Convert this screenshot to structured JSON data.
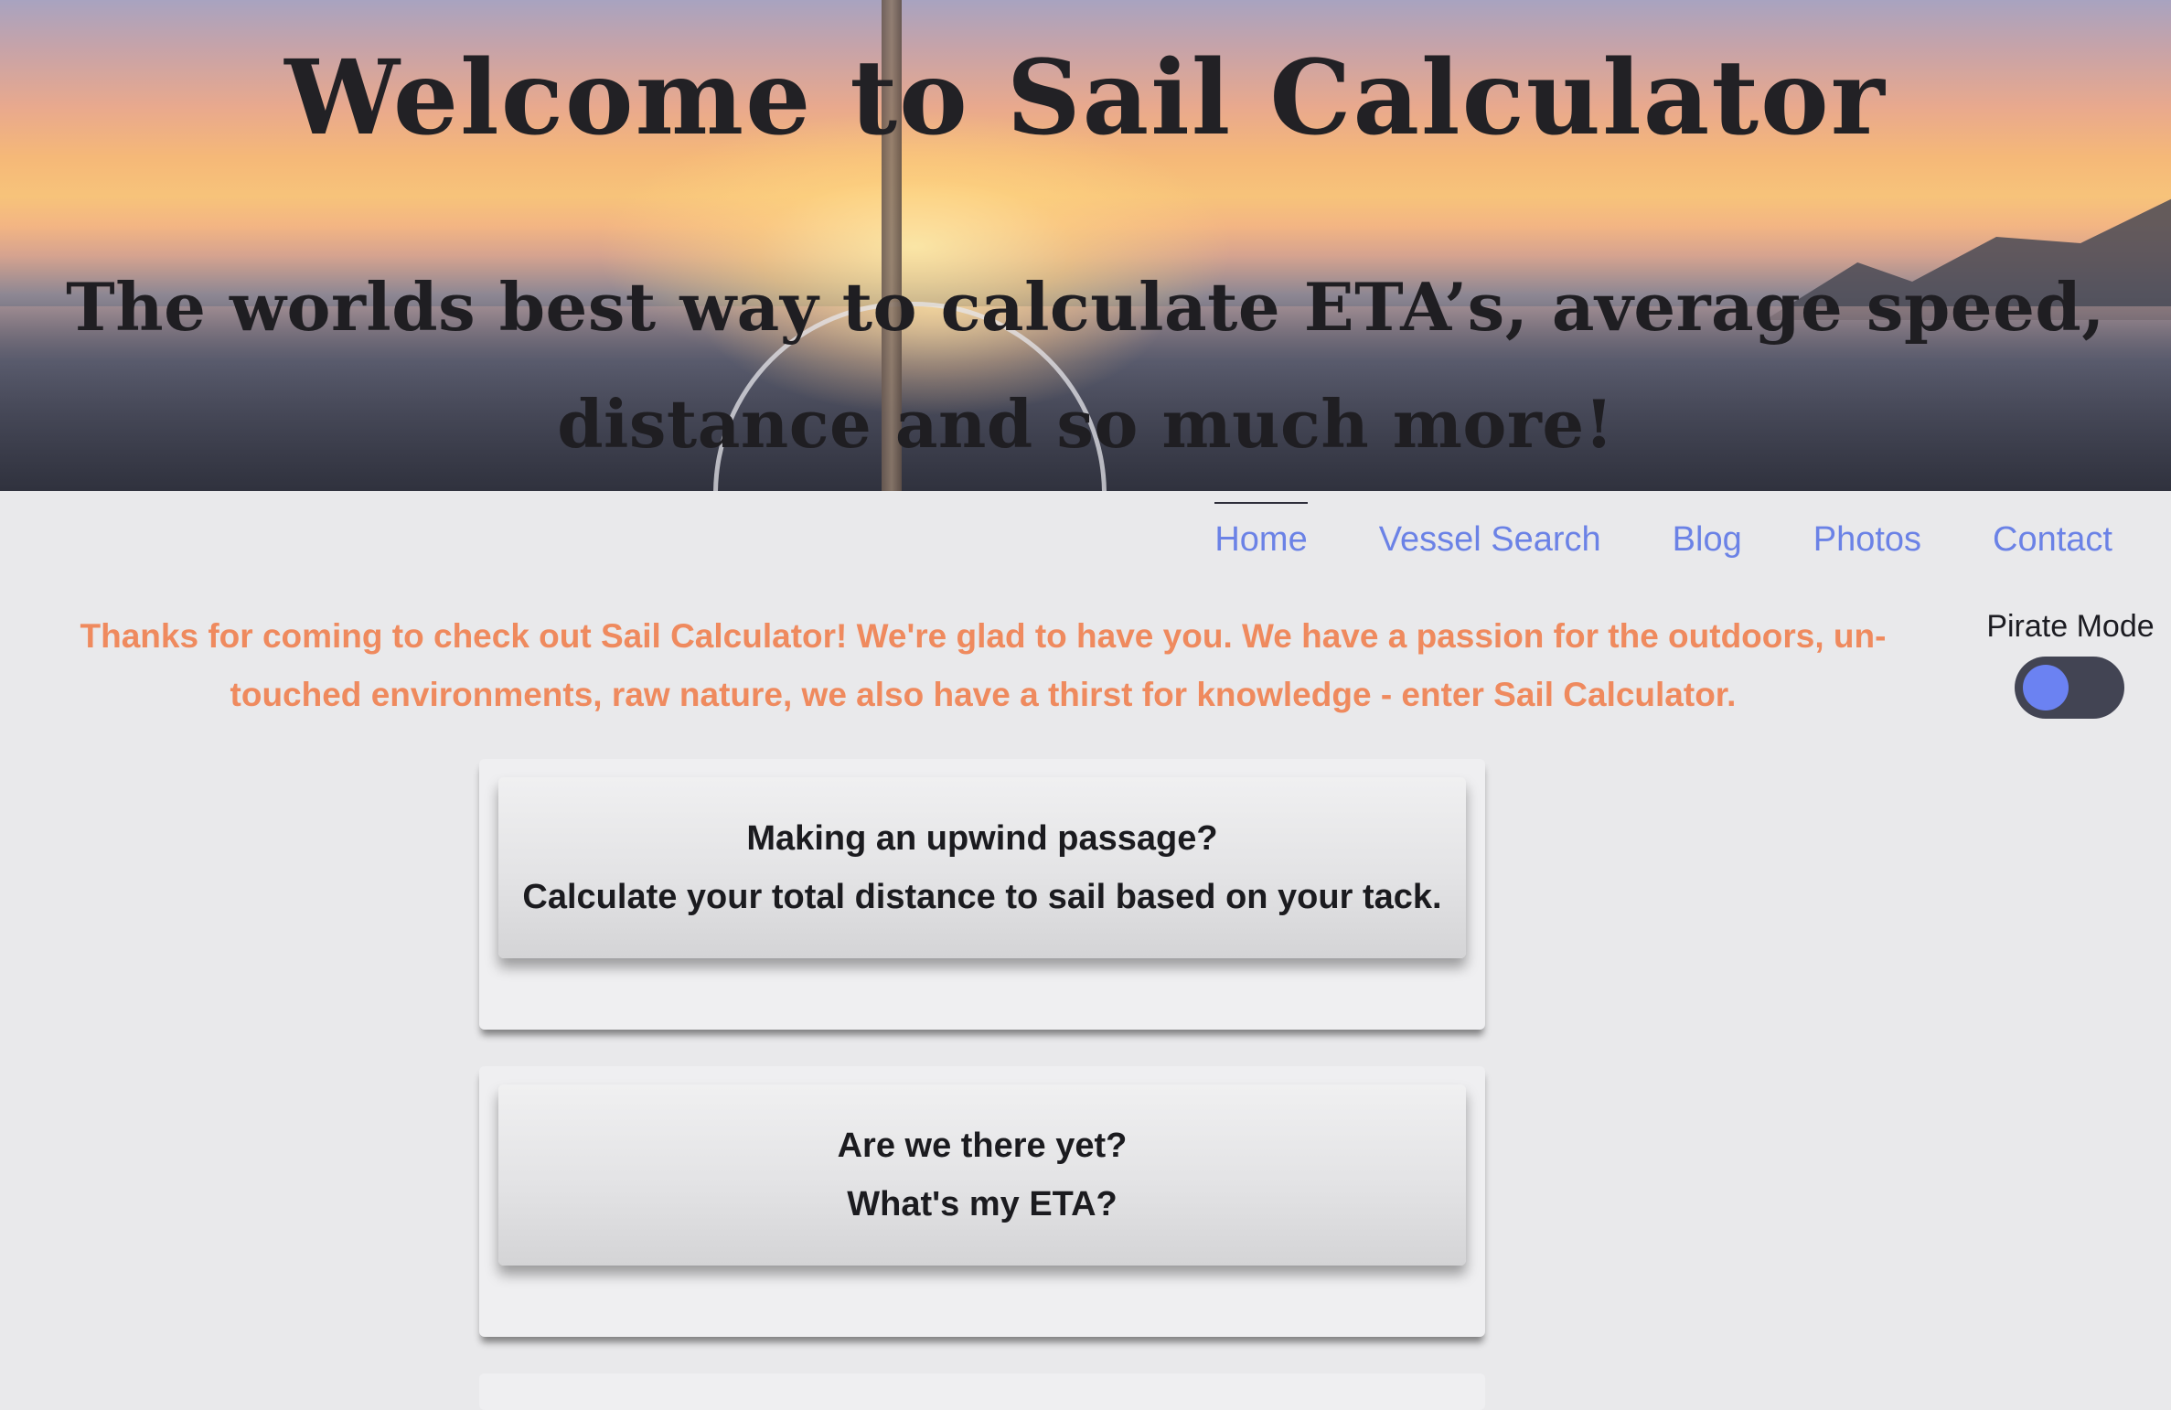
{
  "hero": {
    "title": "Welcome to Sail Calculator",
    "subtitle_line1": "The worlds best way to calculate ETA’s, average speed,",
    "subtitle_line2": "distance and so much more!"
  },
  "nav": {
    "items": [
      {
        "label": "Home",
        "active": true
      },
      {
        "label": "Vessel Search",
        "active": false
      },
      {
        "label": "Blog",
        "active": false
      },
      {
        "label": "Photos",
        "active": false
      },
      {
        "label": "Contact",
        "active": false
      }
    ]
  },
  "intro": {
    "line1": "Thanks for coming to check out Sail Calculator! We're glad to have you. We have a passion for the outdoors, un-",
    "line2": "touched environments, raw nature, we also have a thirst for knowledge - enter Sail Calculator."
  },
  "pirate_mode": {
    "label": "Pirate Mode",
    "on": true
  },
  "cards": [
    {
      "line1": "Making an upwind passage?",
      "line2": "Calculate your total distance to sail based on your tack."
    },
    {
      "line1": "Are we there yet?",
      "line2": "What's my ETA?"
    }
  ],
  "colors": {
    "nav_link": "#6b82e6",
    "intro_text": "#ef8a5e",
    "toggle_track": "#424453",
    "toggle_knob": "#6b82f2",
    "page_background": "#e9e9eb"
  }
}
